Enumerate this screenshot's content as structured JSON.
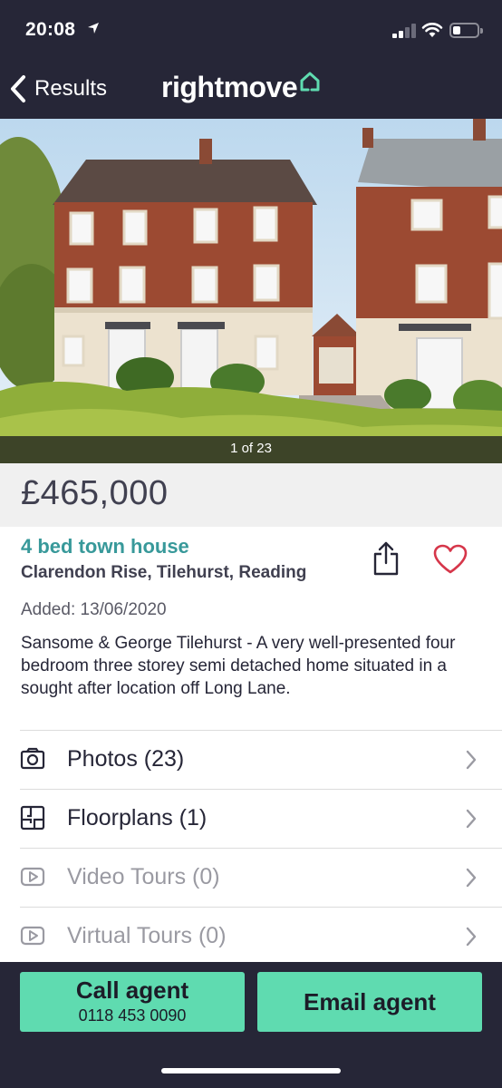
{
  "status_bar": {
    "time": "20:08"
  },
  "header": {
    "back_label": "Results",
    "logo_text": "rightmove"
  },
  "gallery": {
    "counter": "1 of 23"
  },
  "listing": {
    "price": "£465,000",
    "title": "4 bed town house",
    "address": "Clarendon Rise, Tilehurst, Reading",
    "added": "Added: 13/06/2020",
    "description": "Sansome & George Tilehurst - A very well-presented four bedroom three storey semi detached home situated in a sought after location off Long Lane."
  },
  "menu": {
    "photos": "Photos (23)",
    "floorplans": "Floorplans (1)",
    "video_tours": "Video Tours (0)",
    "virtual_tours": "Virtual Tours (0)"
  },
  "actions": {
    "call_label": "Call agent",
    "call_number": "0118 453 0090",
    "email_label": "Email agent"
  },
  "colors": {
    "brand_dark": "#262637",
    "accent_mint": "#5fdbb0",
    "title_teal": "#38999a",
    "heart_red": "#d6364a"
  },
  "icons": {
    "location": "location-arrow-icon",
    "signal": "cellular-signal-icon",
    "wifi": "wifi-icon",
    "battery": "battery-icon",
    "back": "chevron-left-icon",
    "logo": "house-outline-icon",
    "share": "share-icon",
    "favourite": "heart-icon",
    "photos": "camera-icon",
    "floorplans": "floorplan-icon",
    "video": "play-icon",
    "virtual": "play-icon",
    "row_chevron": "chevron-right-icon"
  }
}
